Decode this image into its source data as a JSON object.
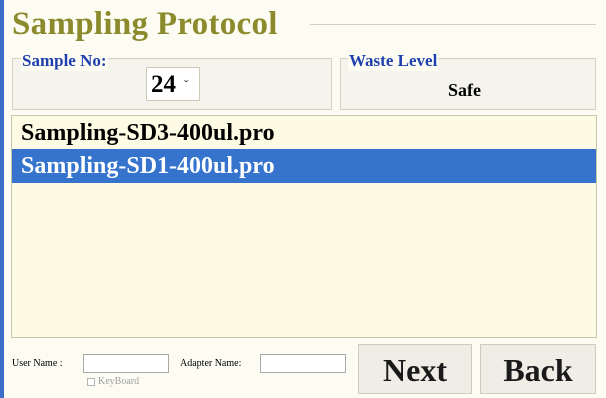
{
  "header": {
    "title": "Sampling Protocol"
  },
  "sample": {
    "label": "Sample No:",
    "value": "24",
    "arrow_icon": "dropdown-arrow-icon"
  },
  "waste": {
    "label": "Waste Level",
    "value": "Safe"
  },
  "protocols": {
    "items": [
      "Sampling-SD3-400ul.pro",
      "Sampling-SD1-400ul.pro"
    ],
    "selected_index": 1
  },
  "footer": {
    "user_name_label": "User Name :",
    "user_name_value": "",
    "adapter_name_label": "Adapter Name:",
    "adapter_name_value": "",
    "keyboard_label": "KeyBoard",
    "keyboard_checked": false,
    "next_label": "Next",
    "back_label": "Back"
  },
  "colors": {
    "title": "#8b8a2c",
    "group_label": "#1e3fae",
    "selection": "#3573cc",
    "list_background": "#fdfbe4"
  }
}
